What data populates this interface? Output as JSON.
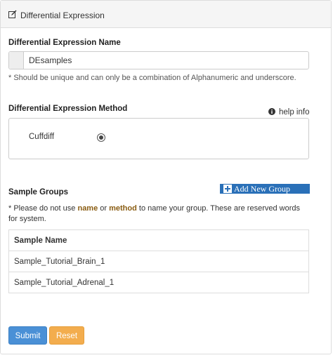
{
  "panel": {
    "heading_icon": "edit-icon",
    "heading": "Differential Expression"
  },
  "de_name": {
    "label": "Differential Expression Name",
    "value": "DEsamples",
    "help": "* Should be unique and can only be a combination of Alphanumeric and underscore."
  },
  "de_method": {
    "label": "Differential Expression Method",
    "help_info": "help info",
    "help_icon": "info-circle-icon",
    "options": [
      {
        "label": "Cuffdiff",
        "selected": true
      }
    ]
  },
  "sample_groups": {
    "label": "Sample Groups",
    "add_button": "Add New Group",
    "add_icon": "plus-square-icon",
    "note_prefix": "* Please do not use ",
    "note_kw1": "name",
    "note_mid": " or ",
    "note_kw2": "method",
    "note_suffix": " to name your group. These are reserved words for system.",
    "table": {
      "header": "Sample Name",
      "rows": [
        "Sample_Tutorial_Brain_1",
        "Sample_Tutorial_Adrenal_1"
      ]
    }
  },
  "actions": {
    "submit": "Submit",
    "reset": "Reset"
  },
  "colors": {
    "submit": "#4a90d6",
    "reset": "#f3ad4e",
    "add_button": "#2a70b8",
    "keyword": "#8a5d13"
  }
}
